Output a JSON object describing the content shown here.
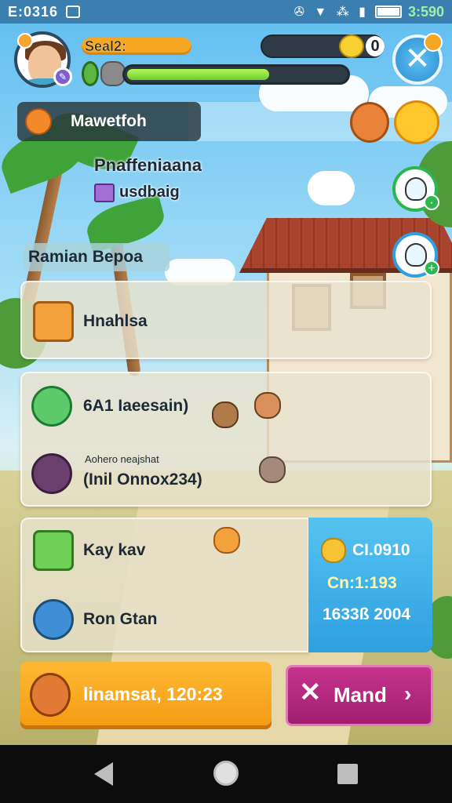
{
  "status_bar": {
    "time": "E:0316",
    "clock": "3:590",
    "icons": "✇ ▼ ⁂ ▮",
    "battery_level": 1.0
  },
  "hud": {
    "player_name": "Seal2:",
    "xp_progress": 0.65,
    "coins": "0"
  },
  "location": {
    "banner_title": "Mawetfoh",
    "quest_title": "Pnaffeniaana",
    "quest_subtitle": "usdbaig",
    "region_label": "Ramian Bepoa"
  },
  "panel_1": {
    "item_label": "Hnahlsa"
  },
  "panel_2": {
    "item_label": "6A1 Iaeesain)",
    "note_small": "Aohero neajshat",
    "note_main": "(Inil Onnox234)"
  },
  "panel_3": {
    "item_label_1": "Kay kav",
    "item_label_2": "Ron Gtan",
    "stats": {
      "line_1": "CI.0910",
      "line_2": "Cn:1:193",
      "line_3": "1633ß 2004"
    }
  },
  "actions": {
    "primary_label": "linamsat, 120:23",
    "mend_label": "Mand",
    "mend_close": "✕",
    "mend_chevron": "›"
  },
  "colors": {
    "accent_orange": "#f5a623",
    "accent_blue": "#2f9fe0",
    "accent_magenta": "#a01e6f",
    "xp_green": "#6ad02a"
  }
}
